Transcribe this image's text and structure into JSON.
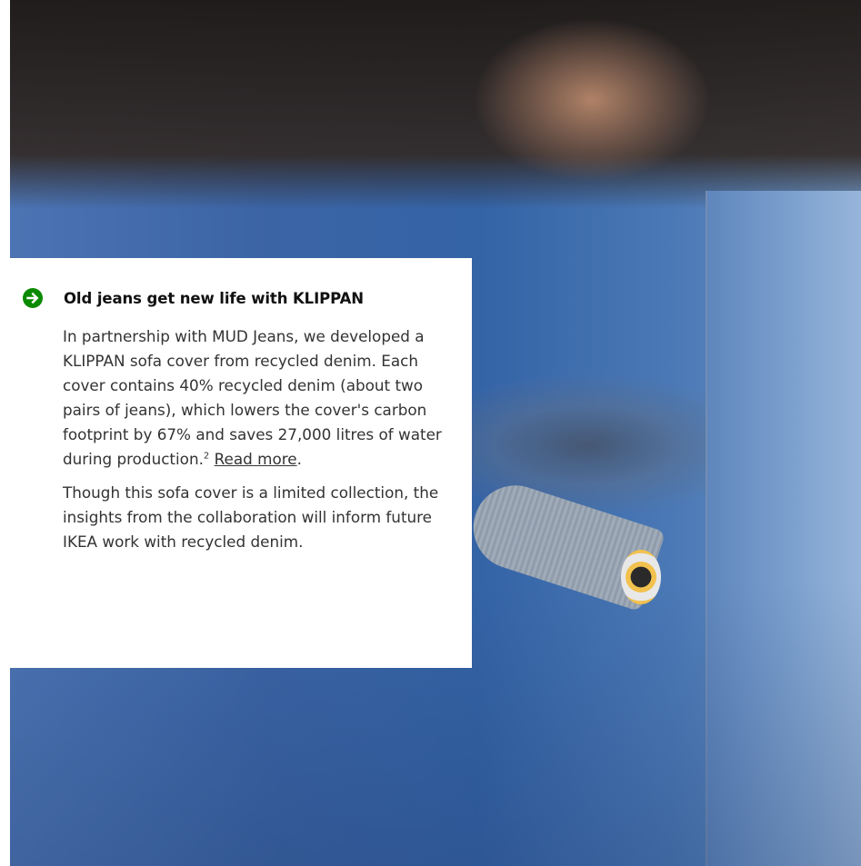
{
  "card": {
    "title": "Old jeans get new life with KLIPPAN",
    "paragraph1_text": "In partnership with MUD Jeans, we developed a KLIPPAN sofa cover from recycled denim. Each cover contains 40% recycled denim (about two pairs of jeans), which lowers the cover's carbon footprint by 67% and saves 27,000 litres of water during production.",
    "footnote_marker": "2",
    "read_more_label": "Read more",
    "after_link": ".",
    "paragraph2": "Though this sofa cover is a limited collection, the insights from the collaboration will inform future IKEA work with recycled denim.",
    "icon": "arrow-right-circle-icon",
    "accent_color": "#0a8a00"
  },
  "hero_image": {
    "alt_subject": "denim-sofa-photo"
  }
}
